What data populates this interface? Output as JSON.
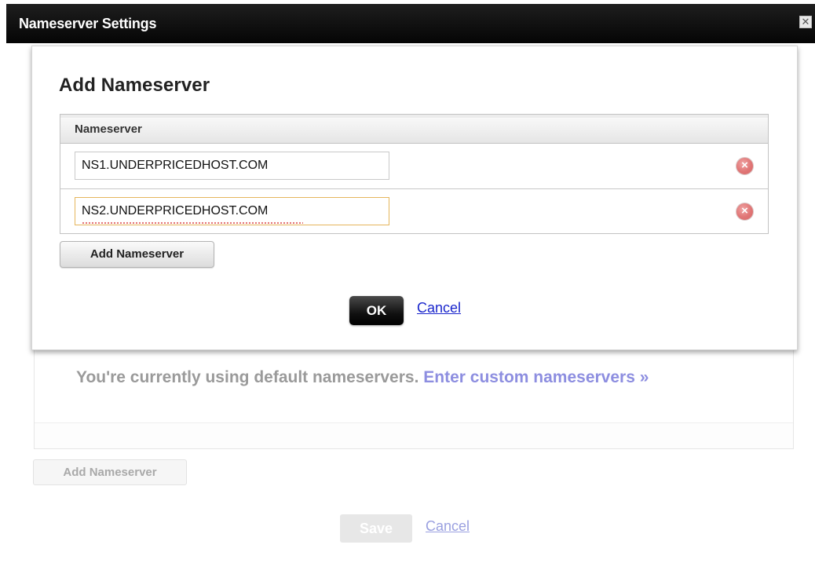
{
  "window": {
    "title": "Nameserver Settings",
    "close_label": "✕"
  },
  "dialog": {
    "title": "Add Nameserver",
    "column_header": "Nameserver",
    "rows": [
      {
        "value": "NS1.UNDERPRICEDHOST.COM",
        "remove_glyph": "×"
      },
      {
        "value": "NS2.UNDERPRICEDHOST.COM",
        "remove_glyph": "×"
      }
    ],
    "add_button": "Add Nameserver",
    "ok_button": "OK",
    "cancel_link": "Cancel"
  },
  "background": {
    "message": "You're currently using default nameservers.",
    "custom_link": "Enter custom nameservers »",
    "add_button": "Add Nameserver",
    "save_button": "Save",
    "cancel_link": "Cancel"
  },
  "colors": {
    "titlebar": "#000000",
    "remove_icon": "#e07575",
    "link": "#1a26cc",
    "focus_border": "#e5b55c"
  }
}
